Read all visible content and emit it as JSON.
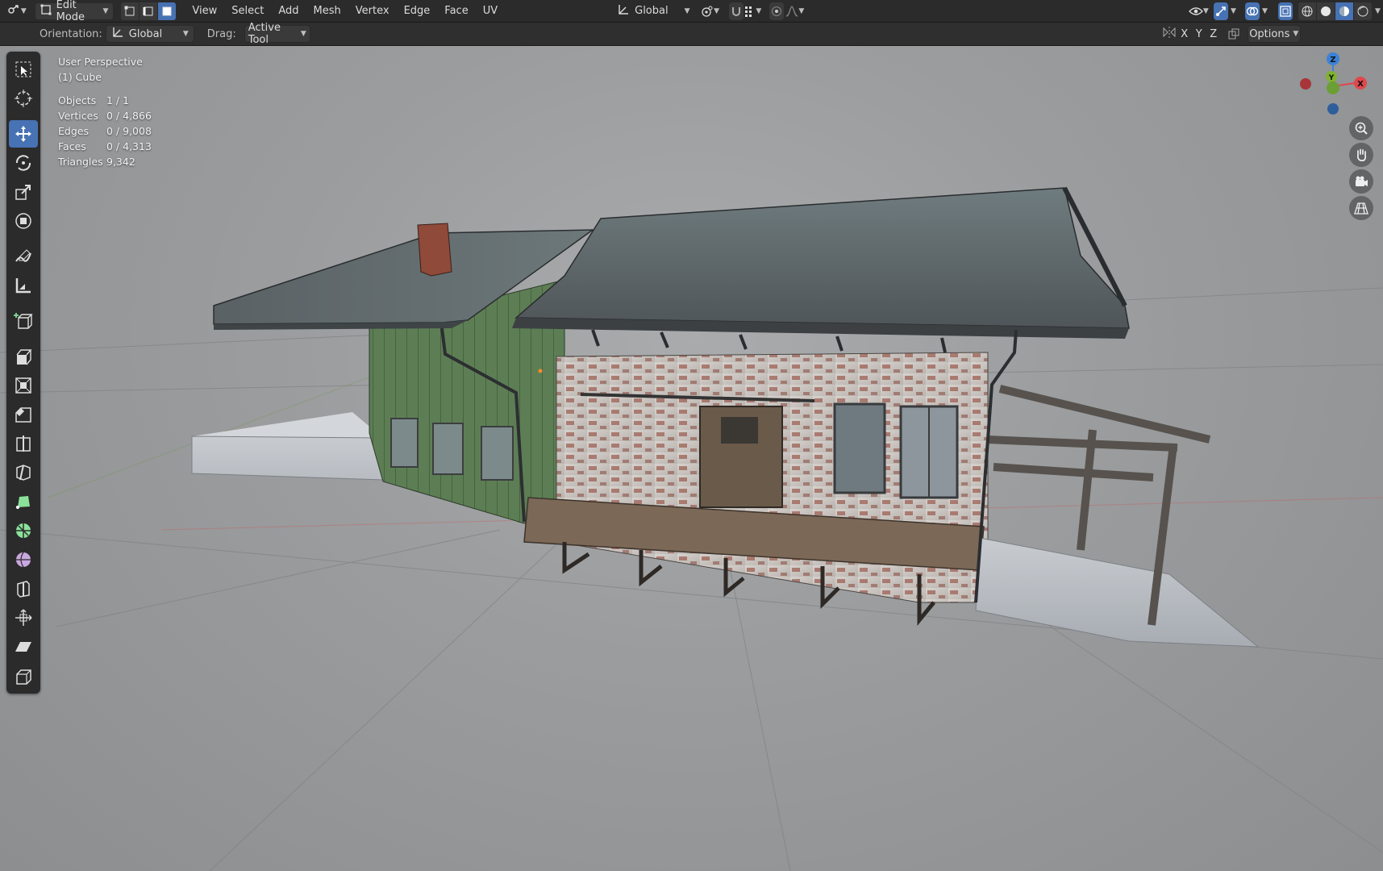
{
  "header": {
    "mode_label": "Edit Mode",
    "menus": [
      "View",
      "Select",
      "Add",
      "Mesh",
      "Vertex",
      "Edge",
      "Face",
      "UV"
    ],
    "transform_orientation": "Global"
  },
  "tool_settings": {
    "orientation_label": "Orientation:",
    "orientation_value": "Global",
    "drag_label": "Drag:",
    "drag_value": "Active Tool",
    "axes": [
      "X",
      "Y",
      "Z"
    ],
    "options_label": "Options"
  },
  "viewport": {
    "view_name": "User Perspective",
    "object_name": "(1) Cube",
    "stats": [
      {
        "label": "Objects",
        "value": "1 / 1"
      },
      {
        "label": "Vertices",
        "value": "0 / 4,866"
      },
      {
        "label": "Edges",
        "value": "0 / 9,008"
      },
      {
        "label": "Faces",
        "value": "0 / 4,313"
      },
      {
        "label": "Triangles",
        "value": "9,342"
      }
    ],
    "gizmo_axes": {
      "z": "Z",
      "y": "Y",
      "x": "X"
    }
  },
  "colors": {
    "accent": "#4772b3",
    "header_bg": "#2b2b2b",
    "axis_x": "#e0474c",
    "axis_y": "#7fb22f",
    "axis_z": "#3b82d6"
  },
  "toolbar_icons": [
    "select-box-icon",
    "cursor-icon",
    "move-icon",
    "rotate-icon",
    "scale-icon",
    "transform-icon",
    "annotate-icon",
    "measure-icon",
    "add-cube-icon",
    "extrude-icon",
    "inset-icon",
    "bevel-icon",
    "loop-cut-icon",
    "knife-icon",
    "poly-build-icon",
    "spin-icon",
    "smooth-icon",
    "edge-slide-icon",
    "shrink-fatten-icon",
    "shear-icon",
    "rip-region-icon"
  ]
}
